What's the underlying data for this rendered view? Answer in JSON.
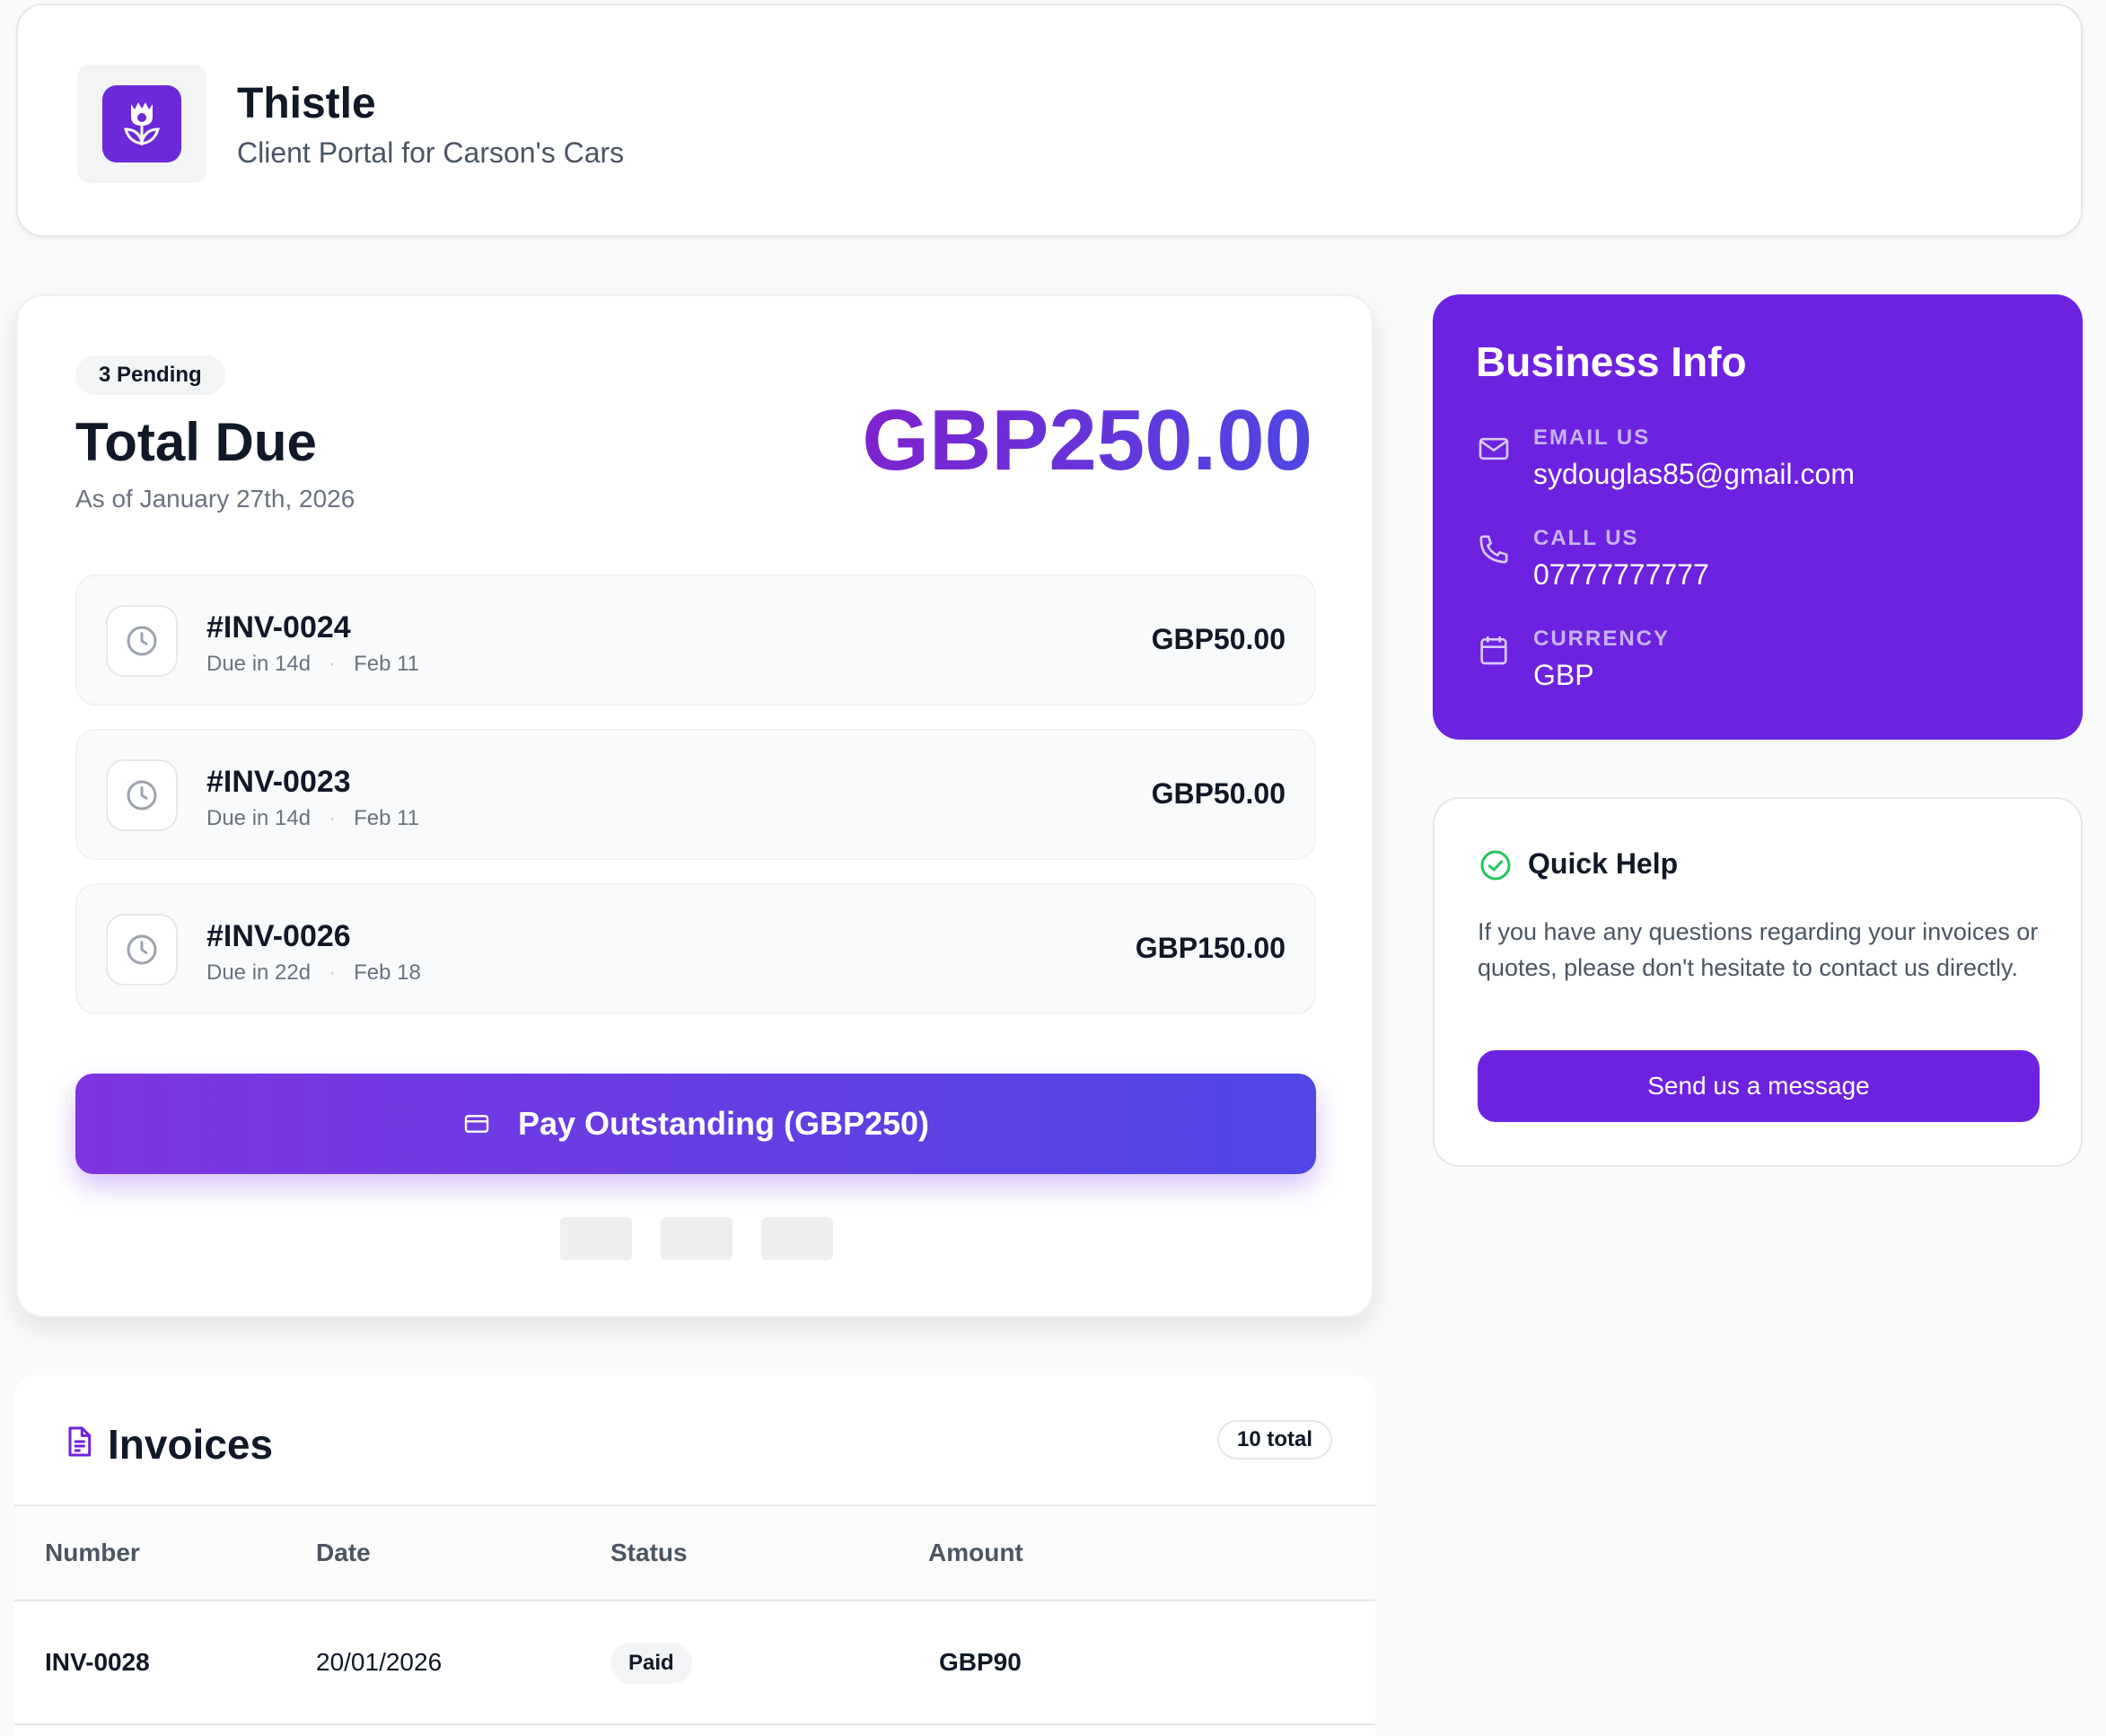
{
  "header": {
    "title": "Thistle",
    "subtitle": "Client Portal for Carson's Cars",
    "logo_icon": "thistle-flower-icon"
  },
  "summary": {
    "pending_badge": "3 Pending",
    "title": "Total Due",
    "as_of": "As of January 27th, 2026",
    "amount": "GBP250.00"
  },
  "pending_invoices": [
    {
      "number": "#INV-0024",
      "due": "Due in 14d",
      "date": "Feb 11",
      "amount": "GBP50.00"
    },
    {
      "number": "#INV-0023",
      "due": "Due in 14d",
      "date": "Feb 11",
      "amount": "GBP50.00"
    },
    {
      "number": "#INV-0026",
      "due": "Due in 22d",
      "date": "Feb 18",
      "amount": "GBP150.00"
    }
  ],
  "separator": "·",
  "pay_button": {
    "label": "Pay Outstanding (GBP250)",
    "icon": "credit-card-icon"
  },
  "invoices": {
    "title": "Invoices",
    "total_badge": "10 total",
    "columns": [
      "Number",
      "Date",
      "Status",
      "Amount"
    ],
    "rows": [
      {
        "number": "INV-0028",
        "date": "20/01/2026",
        "status": "Paid",
        "amount": "GBP90"
      }
    ]
  },
  "business": {
    "title": "Business Info",
    "email_label": "EMAIL US",
    "email": "sydouglas85@gmail.com",
    "phone_label": "CALL US",
    "phone": "07777777777",
    "currency_label": "CURRENCY",
    "currency": "GBP"
  },
  "help": {
    "title": "Quick Help",
    "text": "If you have any questions regarding your invoices or quotes, please don't hesitate to contact us directly.",
    "button": "Send us a message"
  },
  "colors": {
    "accent": "#6d22e0",
    "gradient_start": "#7e22ce",
    "gradient_end": "#4f46e5",
    "success": "#22c55e"
  }
}
